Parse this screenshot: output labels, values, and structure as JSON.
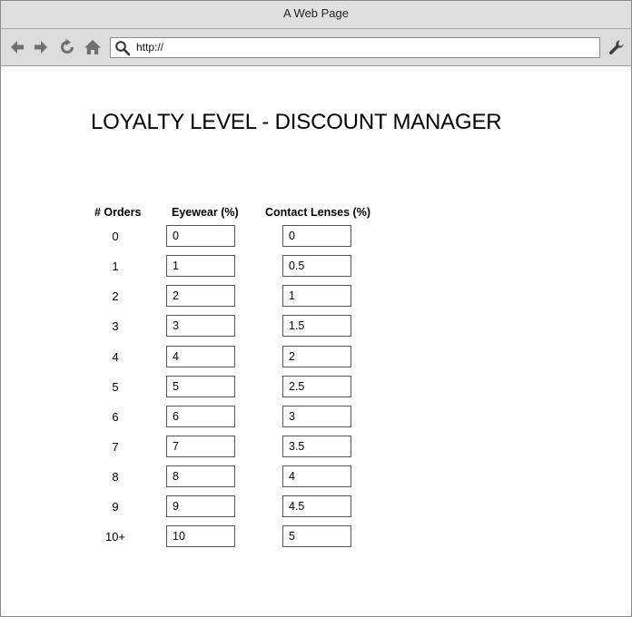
{
  "window": {
    "title": "A Web Page"
  },
  "toolbar": {
    "url": "http://",
    "icons": [
      "back-arrow-icon",
      "forward-arrow-icon",
      "reload-icon",
      "home-icon",
      "search-icon",
      "wrench-icon"
    ]
  },
  "page": {
    "title": "LOYALTY LEVEL - DISCOUNT MANAGER"
  },
  "table": {
    "headers": {
      "orders": "# Orders",
      "eyewear": "Eyewear (%)",
      "contact_lenses": "Contact Lenses (%)"
    },
    "rows": [
      {
        "orders": "0",
        "eyewear": "0",
        "contact_lenses": "0"
      },
      {
        "orders": "1",
        "eyewear": "1",
        "contact_lenses": "0.5"
      },
      {
        "orders": "2",
        "eyewear": "2",
        "contact_lenses": "1"
      },
      {
        "orders": "3",
        "eyewear": "3",
        "contact_lenses": "1.5"
      },
      {
        "orders": "4",
        "eyewear": "4",
        "contact_lenses": "2"
      },
      {
        "orders": "5",
        "eyewear": "5",
        "contact_lenses": "2.5"
      },
      {
        "orders": "6",
        "eyewear": "6",
        "contact_lenses": "3"
      },
      {
        "orders": "7",
        "eyewear": "7",
        "contact_lenses": "3.5"
      },
      {
        "orders": "8",
        "eyewear": "8",
        "contact_lenses": "4"
      },
      {
        "orders": "9",
        "eyewear": "9",
        "contact_lenses": "4.5"
      },
      {
        "orders": "10+",
        "eyewear": "10",
        "contact_lenses": "5"
      }
    ]
  }
}
